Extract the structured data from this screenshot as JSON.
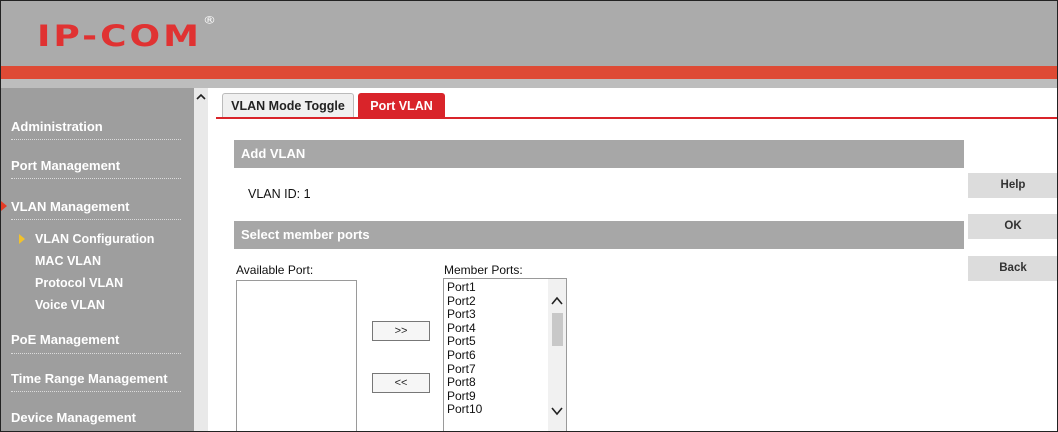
{
  "header": {
    "logo_text": "IP-COM",
    "logo_mark": "®",
    "brand_color": "#e03232",
    "bar_color": "#de4a35"
  },
  "sidebar": {
    "items": [
      {
        "label": "Administration"
      },
      {
        "label": "Port Management"
      },
      {
        "label": "VLAN Management",
        "active": true
      },
      {
        "label": "PoE Management"
      },
      {
        "label": "Time Range Management"
      },
      {
        "label": "Device Management"
      }
    ],
    "sub_items": [
      {
        "label": "VLAN Configuration",
        "active": true
      },
      {
        "label": "MAC VLAN"
      },
      {
        "label": "Protocol VLAN"
      },
      {
        "label": "Voice VLAN"
      }
    ]
  },
  "tabs": [
    {
      "label": "VLAN Mode Toggle",
      "active": false
    },
    {
      "label": "Port VLAN",
      "active": true
    }
  ],
  "main": {
    "add_vlan_title": "Add VLAN",
    "vlan_id_text": "VLAN ID: 1",
    "select_ports_title": "Select member ports",
    "available_label": "Available Port:",
    "member_label": "Member Ports:",
    "add_button": ">>",
    "remove_button": "<<",
    "member_ports": [
      "Port1",
      "Port2",
      "Port3",
      "Port4",
      "Port5",
      "Port6",
      "Port7",
      "Port8",
      "Port9",
      "Port10"
    ]
  },
  "actions": {
    "help": "Help",
    "ok": "OK",
    "back": "Back"
  }
}
